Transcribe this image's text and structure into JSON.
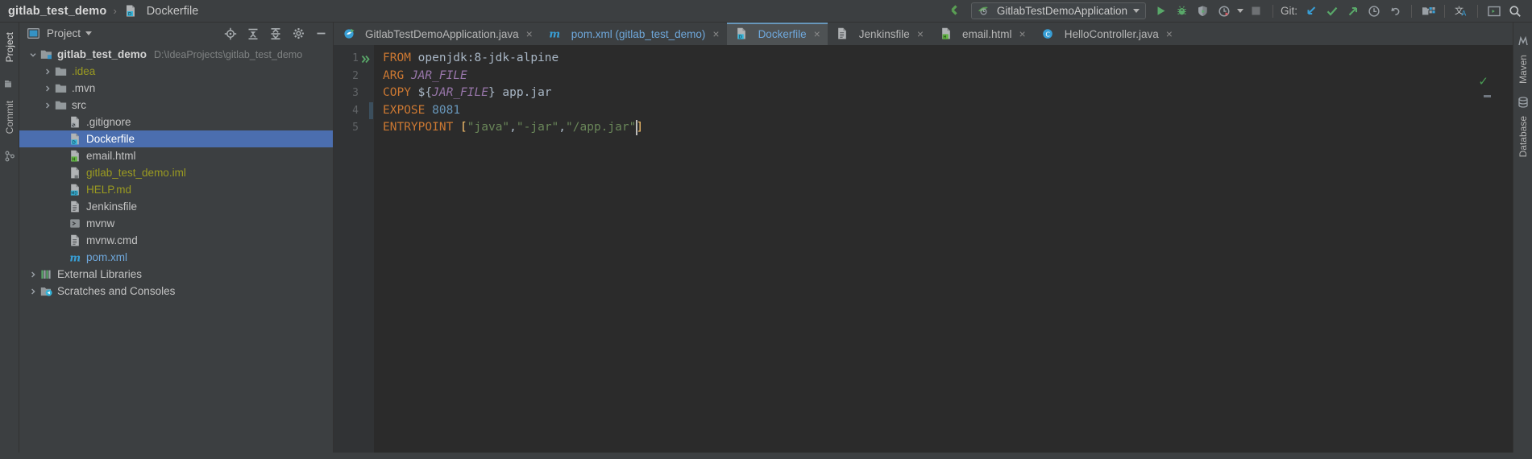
{
  "breadcrumb": {
    "project": "gitlab_test_demo",
    "separator": "›",
    "file": "Dockerfile"
  },
  "toolbar": {
    "run_config": "GitlabTestDemoApplication",
    "git_label": "Git:",
    "icons": [
      "back-arrow-icon",
      "run-icon",
      "debug-icon",
      "coverage-icon",
      "profiler-icon",
      "stop-icon",
      "git-update-icon",
      "git-commit-icon",
      "git-push-icon",
      "git-history-icon",
      "git-rollback-icon",
      "project-structure-icon",
      "translate-icon",
      "terminal-icon",
      "search-icon"
    ]
  },
  "left_strip": {
    "tabs": [
      "Project",
      "Commit"
    ]
  },
  "right_strip": {
    "tabs": [
      "Maven",
      "Database"
    ]
  },
  "project_panel": {
    "title": "Project",
    "tree": [
      {
        "indent": 0,
        "arrow": "down",
        "icon": "project-folder-icon",
        "label": "gitlab_test_demo",
        "style": "bold",
        "path": "D:\\IdeaProjects\\gitlab_test_demo"
      },
      {
        "indent": 1,
        "arrow": "right",
        "icon": "folder-icon",
        "label": ".idea",
        "style": "ignored",
        "path": ""
      },
      {
        "indent": 1,
        "arrow": "right",
        "icon": "folder-icon",
        "label": ".mvn",
        "style": "white",
        "path": ""
      },
      {
        "indent": 1,
        "arrow": "right",
        "icon": "folder-icon",
        "label": "src",
        "style": "white",
        "path": ""
      },
      {
        "indent": 2,
        "arrow": "none",
        "icon": "gitignore-file-icon",
        "label": ".gitignore",
        "style": "white",
        "path": ""
      },
      {
        "indent": 2,
        "arrow": "none",
        "icon": "dockerfile-icon",
        "label": "Dockerfile",
        "style": "selected",
        "path": ""
      },
      {
        "indent": 2,
        "arrow": "none",
        "icon": "html-file-icon",
        "label": "email.html",
        "style": "white",
        "path": ""
      },
      {
        "indent": 2,
        "arrow": "none",
        "icon": "iml-file-icon",
        "label": "gitlab_test_demo.iml",
        "style": "ignored",
        "path": ""
      },
      {
        "indent": 2,
        "arrow": "none",
        "icon": "markdown-file-icon",
        "label": "HELP.md",
        "style": "ignored",
        "path": ""
      },
      {
        "indent": 2,
        "arrow": "none",
        "icon": "text-file-icon",
        "label": "Jenkinsfile",
        "style": "white",
        "path": ""
      },
      {
        "indent": 2,
        "arrow": "none",
        "icon": "shell-script-icon",
        "label": "mvnw",
        "style": "white",
        "path": ""
      },
      {
        "indent": 2,
        "arrow": "none",
        "icon": "text-file-icon",
        "label": "mvnw.cmd",
        "style": "white",
        "path": ""
      },
      {
        "indent": 2,
        "arrow": "none",
        "icon": "maven-file-icon",
        "label": "pom.xml",
        "style": "blue",
        "path": ""
      },
      {
        "indent": 0,
        "arrow": "right",
        "icon": "libraries-icon",
        "label": "External Libraries",
        "style": "white",
        "path": ""
      },
      {
        "indent": 0,
        "arrow": "right",
        "icon": "scratches-icon",
        "label": "Scratches and Consoles",
        "style": "white",
        "path": ""
      }
    ]
  },
  "editor": {
    "tabs": [
      {
        "label": "GitlabTestDemoApplication.java",
        "icon": "spring-class-icon",
        "active": false,
        "blue": false
      },
      {
        "label": "pom.xml (gitlab_test_demo)",
        "icon": "maven-file-icon",
        "active": false,
        "blue": true
      },
      {
        "label": "Dockerfile",
        "icon": "dockerfile-icon",
        "active": true,
        "blue": true
      },
      {
        "label": "Jenkinsfile",
        "icon": "text-file-icon",
        "active": false,
        "blue": false
      },
      {
        "label": "email.html",
        "icon": "html-file-icon",
        "active": false,
        "blue": false
      },
      {
        "label": "HelloController.java",
        "icon": "java-class-icon",
        "active": false,
        "blue": false
      }
    ],
    "close_glyph": "×",
    "line_numbers": [
      "1",
      "2",
      "3",
      "4",
      "5"
    ],
    "code_lines": [
      {
        "n": "1",
        "tokens": [
          {
            "t": "FROM",
            "c": "kw"
          },
          {
            "t": " openjdk:8-jdk-alpine",
            "c": "val"
          }
        ]
      },
      {
        "n": "2",
        "tokens": [
          {
            "t": "ARG",
            "c": "kw"
          },
          {
            "t": " ",
            "c": "val"
          },
          {
            "t": "JAR_FILE",
            "c": "var"
          }
        ]
      },
      {
        "n": "3",
        "tokens": [
          {
            "t": "COPY",
            "c": "kw"
          },
          {
            "t": " ${",
            "c": "brace"
          },
          {
            "t": "JAR_FILE",
            "c": "var"
          },
          {
            "t": "}",
            "c": "brace"
          },
          {
            "t": " app.jar",
            "c": "val"
          }
        ]
      },
      {
        "n": "4",
        "tokens": [
          {
            "t": "EXPOSE",
            "c": "kw"
          },
          {
            "t": " ",
            "c": "val"
          },
          {
            "t": "8081",
            "c": "num"
          }
        ]
      },
      {
        "n": "5",
        "tokens": [
          {
            "t": "ENTRYPOINT",
            "c": "kw"
          },
          {
            "t": " ",
            "c": "val"
          },
          {
            "t": "[",
            "c": "brk"
          },
          {
            "t": "\"java\"",
            "c": "str"
          },
          {
            "t": ",",
            "c": "val"
          },
          {
            "t": "\"-jar\"",
            "c": "str"
          },
          {
            "t": ",",
            "c": "val"
          },
          {
            "t": "\"/app.jar\"",
            "c": "str"
          },
          {
            "t": "]",
            "c": "brk"
          }
        ]
      }
    ],
    "inspection_status": "✓"
  },
  "colors": {
    "accent_blue": "#6897bb",
    "selection_blue": "#4b6eaf",
    "keyword_orange": "#cc7832",
    "string_green": "#6a8759",
    "number_blue": "#6897bb",
    "variable_purple": "#9876aa",
    "bracket_yellow": "#ffc66d",
    "ok_green": "#499c54",
    "editor_bg": "#2b2b2b",
    "panel_bg": "#3c3f41"
  }
}
